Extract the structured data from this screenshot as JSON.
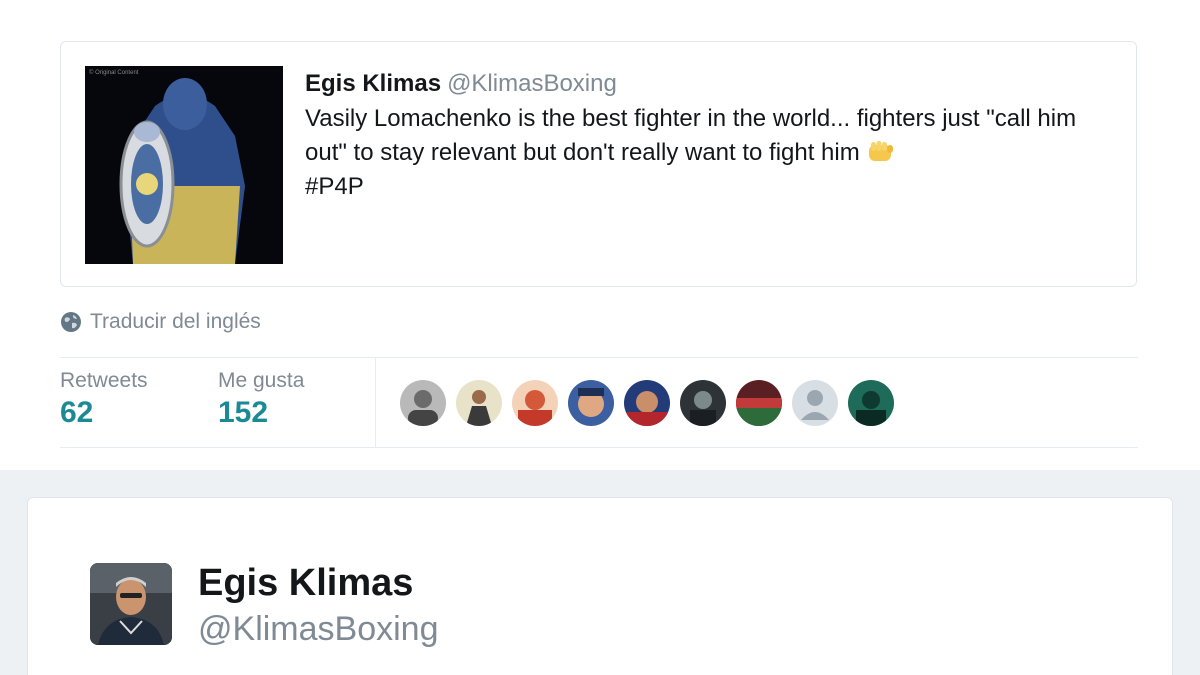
{
  "quoted_tweet": {
    "name": "Egis Klimas",
    "handle": "@KlimasBoxing",
    "text_before_emoji": "Vasily Lomachenko is the best fighter in the world... fighters just \"call him out\" to stay relevant but don't really want to fight him ",
    "emoji": "fist-icon",
    "hashtag": "#P4P",
    "media_caption": "© Original Content"
  },
  "translate": {
    "label": "Traducir del inglés",
    "icon": "globe-icon"
  },
  "stats": {
    "retweets_label": "Retweets",
    "retweets_value": "62",
    "likes_label": "Me gusta",
    "likes_value": "152",
    "accent_color": "#1b8a95"
  },
  "liked_by_avatars": [
    "avatar-grayscale",
    "avatar-suit",
    "avatar-red",
    "avatar-face",
    "avatar-blue-red",
    "avatar-dark",
    "avatar-stadium",
    "avatar-default",
    "avatar-green"
  ],
  "profile": {
    "name": "Egis Klimas",
    "handle": "@KlimasBoxing"
  }
}
